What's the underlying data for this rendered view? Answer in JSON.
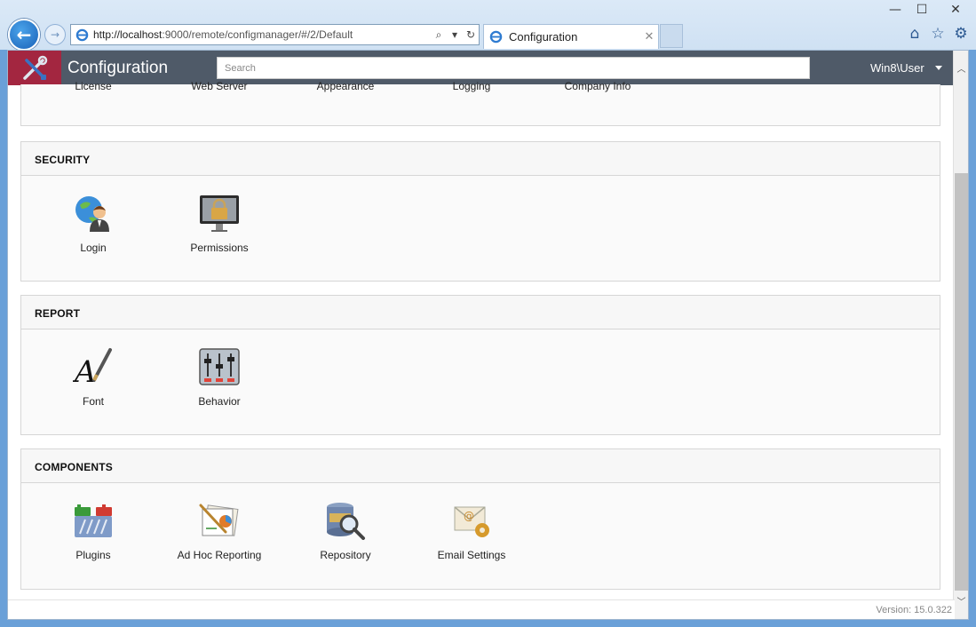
{
  "browser": {
    "url_host": "http://localhost",
    "url_rest": ":9000/remote/configmanager/#/2/Default",
    "tab_title": "Configuration",
    "controls": {
      "minimize": "—",
      "maximize": "☐",
      "close": "✕"
    }
  },
  "app": {
    "title": "Configuration",
    "search_placeholder": "Search",
    "user": "Win8\\User",
    "version": "Version: 15.0.322"
  },
  "top_section": {
    "items": [
      {
        "label": "License"
      },
      {
        "label": "Web Server"
      },
      {
        "label": "Appearance"
      },
      {
        "label": "Logging"
      },
      {
        "label": "Company Info"
      }
    ]
  },
  "sections": [
    {
      "title": "SECURITY",
      "items": [
        {
          "label": "Login",
          "icon": "login-icon"
        },
        {
          "label": "Permissions",
          "icon": "permissions-icon"
        }
      ]
    },
    {
      "title": "REPORT",
      "items": [
        {
          "label": "Font",
          "icon": "font-icon"
        },
        {
          "label": "Behavior",
          "icon": "behavior-icon"
        }
      ]
    },
    {
      "title": "COMPONENTS",
      "items": [
        {
          "label": "Plugins",
          "icon": "plugins-icon"
        },
        {
          "label": "Ad Hoc Reporting",
          "icon": "adhoc-reporting-icon"
        },
        {
          "label": "Repository",
          "icon": "repository-icon"
        },
        {
          "label": "Email Settings",
          "icon": "email-settings-icon"
        }
      ]
    }
  ]
}
